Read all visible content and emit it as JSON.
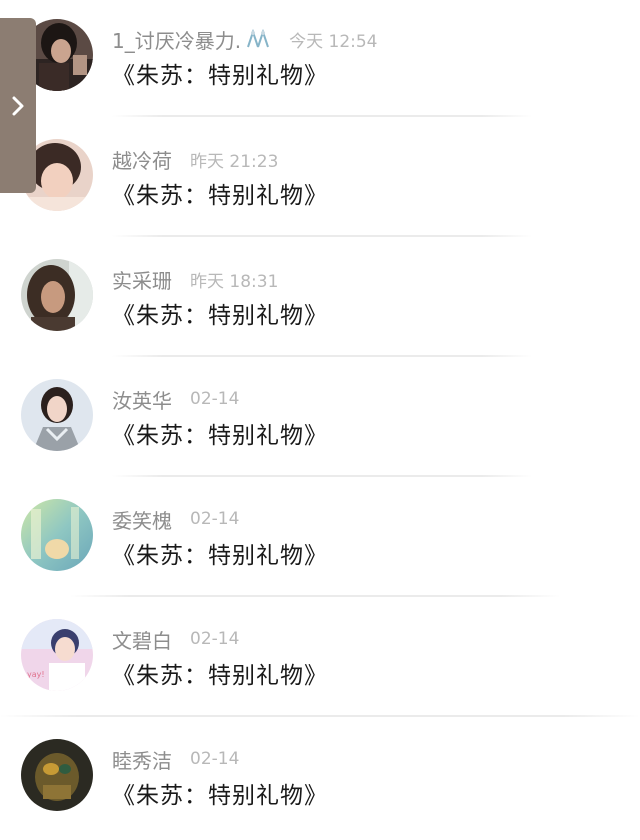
{
  "side_panel": {
    "icon": "chevron-right-icon"
  },
  "items": [
    {
      "name": "1_讨厌冷暴力.",
      "time": "今天 12:54",
      "title": "《朱苏：特别礼物》",
      "name_emoji": "emoji-icon"
    },
    {
      "name": "越冷荷",
      "time": "昨天 21:23",
      "title": "《朱苏：特别礼物》"
    },
    {
      "name": "实采珊",
      "time": "昨天 18:31",
      "title": "《朱苏：特别礼物》"
    },
    {
      "name": "汝英华",
      "time": "02-14",
      "title": "《朱苏：特别礼物》"
    },
    {
      "name": "委笑槐",
      "time": "02-14",
      "title": "《朱苏：特别礼物》"
    },
    {
      "name": "文碧白",
      "time": "02-14",
      "title": "《朱苏：特别礼物》"
    },
    {
      "name": "睦秀洁",
      "time": "02-14",
      "title": "《朱苏：特别礼物》"
    }
  ],
  "colors": {
    "background": "#ffffff",
    "name": "#8d8d8d",
    "time": "#b8b8b8",
    "title": "#1a1a1a",
    "side_tab": "#8c7d72"
  }
}
